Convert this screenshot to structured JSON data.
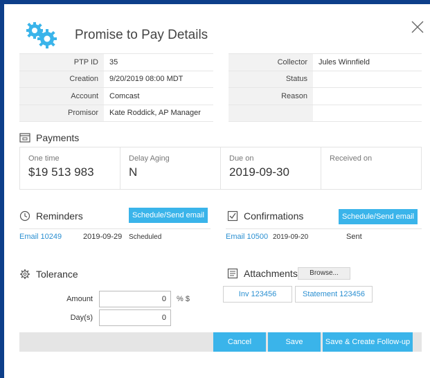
{
  "dialog": {
    "title": "Promise to Pay Details",
    "close_icon": "close-icon",
    "title_icon": "gears-icon"
  },
  "info_left": [
    {
      "label": "PTP ID",
      "value": "35"
    },
    {
      "label": "Creation",
      "value": "9/20/2019 08:00 MDT"
    },
    {
      "label": "Account",
      "value": "Comcast"
    },
    {
      "label": "Promisor",
      "value": "Kate Roddick, AP Manager"
    }
  ],
  "info_right": [
    {
      "label": "Collector",
      "value": "Jules Winnfield"
    },
    {
      "label": "Status",
      "value": ""
    },
    {
      "label": "Reason",
      "value": ""
    },
    {
      "label": "",
      "value": ""
    }
  ],
  "payments": {
    "title": "Payments",
    "cells": [
      {
        "label": "One time",
        "value": "$19 513 983"
      },
      {
        "label": "Delay Aging",
        "value": "N"
      },
      {
        "label": "Due on",
        "value": "2019-09-30"
      },
      {
        "label": "Received on",
        "value": ""
      }
    ]
  },
  "reminders": {
    "title": "Reminders",
    "button": "Schedule/Send email",
    "row": {
      "email": "Email 10249",
      "date": "2019-09-29",
      "status": "Scheduled"
    }
  },
  "confirmations": {
    "title": "Confirmations",
    "button": "Schedule/Send email",
    "row": {
      "email": "Email 10500",
      "date": "2019-09-20",
      "status": "Sent"
    }
  },
  "tolerance": {
    "title": "Tolerance",
    "amount_label": "Amount",
    "amount_value": "0",
    "amount_unit": "% $",
    "days_label": "Day(s)",
    "days_value": "0"
  },
  "attachments": {
    "title": "Attachments",
    "browse": "Browse...",
    "files": [
      "Inv 123456",
      "Statement 123456"
    ]
  },
  "footer": {
    "cancel": "Cancel",
    "save": "Save",
    "save_follow": "Save & Create Follow-up"
  },
  "colors": {
    "accent": "#3ab4ea",
    "link": "#2a8fd1",
    "frame": "#0d3f8a"
  }
}
